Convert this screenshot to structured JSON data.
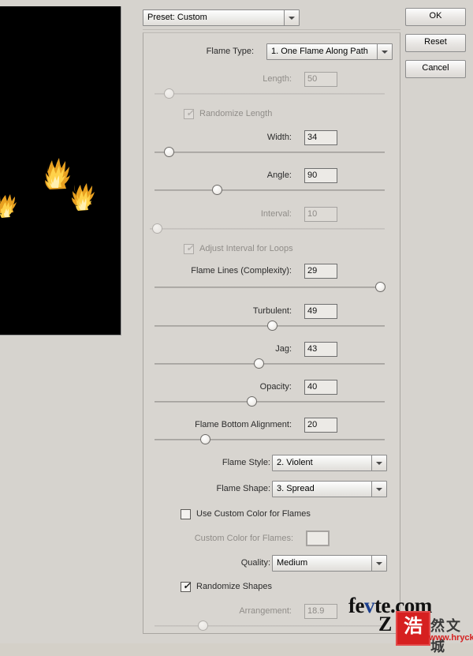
{
  "dialog": {
    "preset": {
      "label": "Preset: Custom"
    },
    "buttons": [
      {
        "name": "ok",
        "label": "OK"
      },
      {
        "name": "reset",
        "label": "Reset"
      },
      {
        "name": "cancel",
        "label": "Cancel"
      }
    ]
  },
  "controls": {
    "flame_type": {
      "label": "Flame Type:",
      "value": "1. One Flame Along Path"
    },
    "length": {
      "label": "Length:",
      "value": "50",
      "slider_pct": 4,
      "disabled": true
    },
    "randomize_length": {
      "label": "Randomize Length",
      "checked": true,
      "disabled": true
    },
    "width": {
      "label": "Width:",
      "value": "34",
      "slider_pct": 4,
      "disabled": false
    },
    "angle": {
      "label": "Angle:",
      "value": "90",
      "slider_pct": 25,
      "disabled": false
    },
    "interval": {
      "label": "Interval:",
      "value": "10",
      "slider_pct": 1,
      "disabled": true
    },
    "adjust_interval": {
      "label": "Adjust Interval for Loops",
      "checked": true,
      "disabled": true
    },
    "flame_lines": {
      "label": "Flame Lines (Complexity):",
      "value": "29",
      "slider_pct": 96,
      "disabled": false
    },
    "turbulent": {
      "label": "Turbulent:",
      "value": "49",
      "slider_pct": 49,
      "disabled": false
    },
    "jag": {
      "label": "Jag:",
      "value": "43",
      "slider_pct": 43,
      "disabled": false
    },
    "opacity": {
      "label": "Opacity:",
      "value": "40",
      "slider_pct": 40,
      "disabled": false
    },
    "flame_bottom": {
      "label": "Flame Bottom Alignment:",
      "value": "20",
      "slider_pct": 20,
      "disabled": false
    },
    "flame_style": {
      "label": "Flame Style:",
      "value": "2. Violent"
    },
    "flame_shape": {
      "label": "Flame Shape:",
      "value": "3. Spread"
    },
    "use_custom_color": {
      "label": "Use Custom Color for Flames",
      "checked": false,
      "disabled": false
    },
    "custom_color": {
      "label": "Custom Color for Flames:",
      "swatch": "#eceae6",
      "disabled": true
    },
    "quality": {
      "label": "Quality:",
      "value": "Medium"
    },
    "randomize_shapes": {
      "label": "Randomize Shapes",
      "checked": true,
      "disabled": false
    },
    "arrangement": {
      "label": "Arrangement:",
      "value": "18.9",
      "slider_pct": 19,
      "disabled": true
    }
  },
  "preview": {
    "background": "#000000",
    "flame_color": "#e8a020"
  },
  "watermark": {
    "site": "fe",
    "site_v": "v",
    "site_rest": "te.com",
    "z": "Z",
    "seal": "浩",
    "chinese": "然文城",
    "url": "www.hryckj.cn"
  }
}
